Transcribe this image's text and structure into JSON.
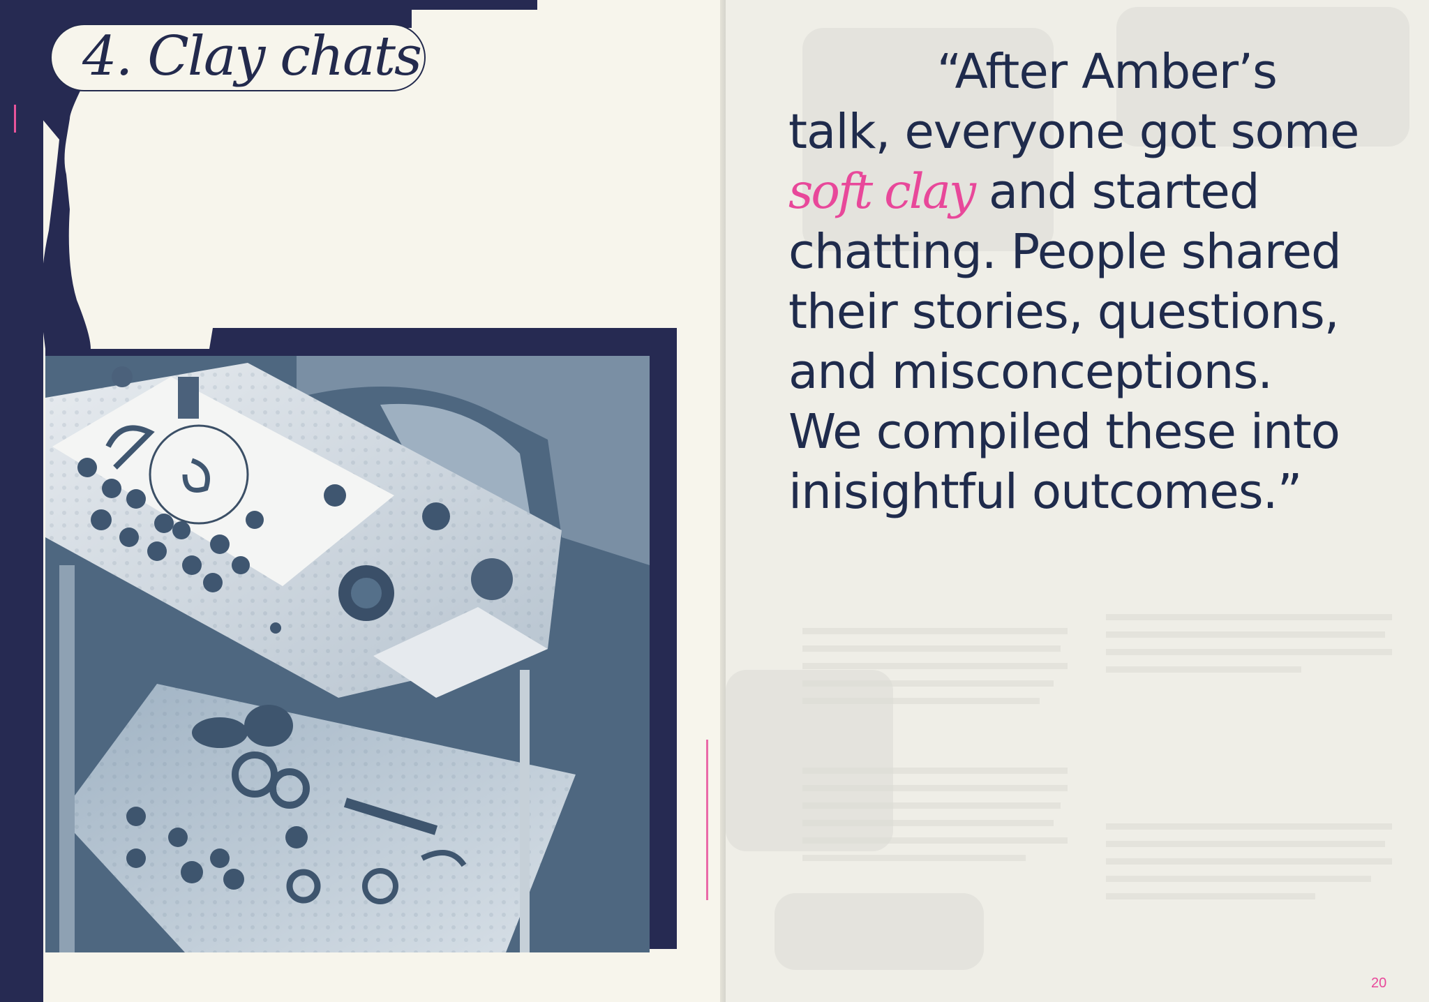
{
  "left_page": {
    "heading": "4. Clay chats"
  },
  "right_page": {
    "quote": {
      "line1": "“After Amber’s",
      "line2": "talk, everyone got some",
      "line3_accent": "soft clay",
      "line3_rest": " and started",
      "line4": "chatting. People shared",
      "line5": "their stories, questions,",
      "line6": "and misconceptions.",
      "line7": "We compiled these into",
      "line8": "inisightful outcomes.”"
    },
    "page_number": "20"
  },
  "colors": {
    "navy": "#262a52",
    "accent_pink": "#e8489a",
    "text_navy": "#1f2b4c",
    "paper": "#f7f5ec"
  }
}
